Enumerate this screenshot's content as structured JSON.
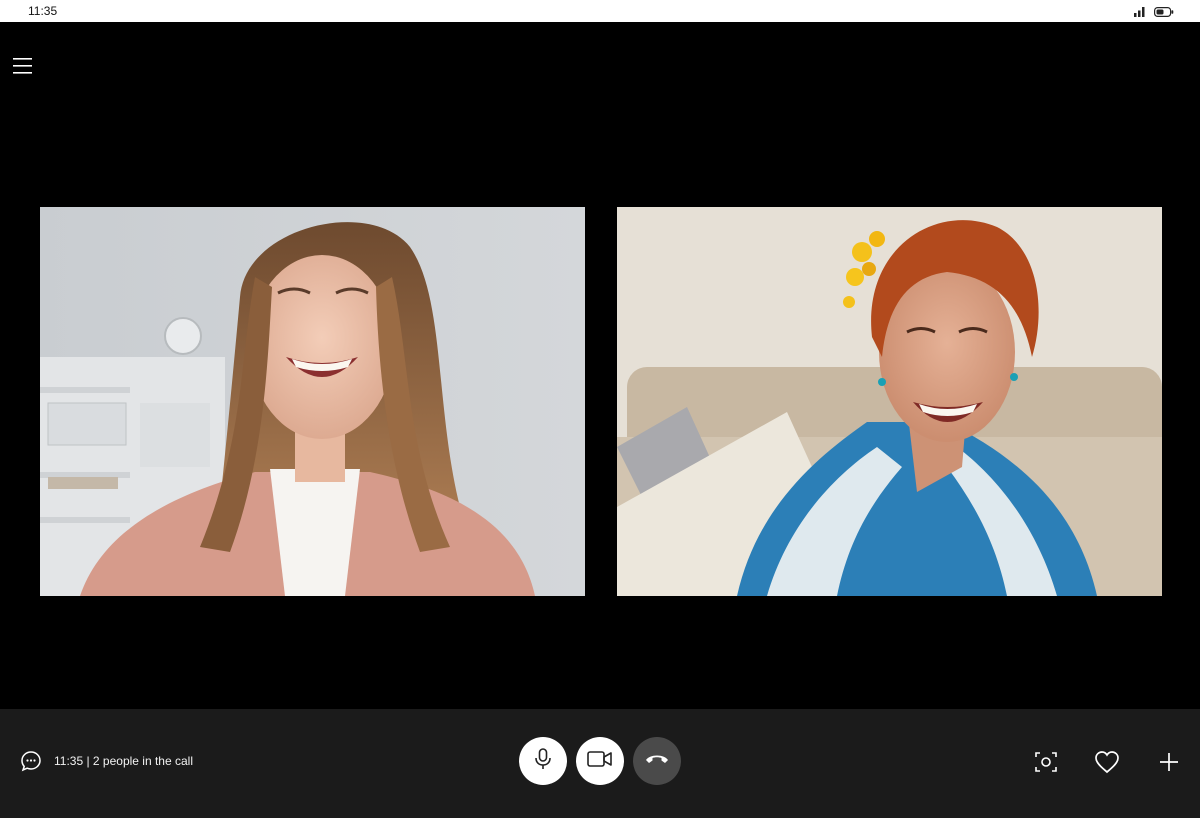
{
  "status_bar": {
    "time": "11:35",
    "signal_icon": "signal-bars-icon",
    "battery_icon": "battery-icon"
  },
  "menu": {
    "icon": "hamburger-menu-icon"
  },
  "participants": [
    {
      "label": "participant-1",
      "description_icon": "video-feed"
    },
    {
      "label": "participant-2",
      "description_icon": "video-feed"
    }
  ],
  "controls": {
    "chat_icon": "chat-bubble-icon",
    "call_info": "11:35 | 2 people in the call",
    "mic_icon": "microphone-icon",
    "video_icon": "video-camera-icon",
    "hangup_icon": "hang-up-icon",
    "snapshot_icon": "snapshot-icon",
    "reaction_icon": "heart-icon",
    "add_icon": "plus-icon"
  },
  "colors": {
    "background": "#000000",
    "control_bar": "#1b1b1b",
    "hangup": "#4a4a4a",
    "button_light": "#ffffff"
  }
}
